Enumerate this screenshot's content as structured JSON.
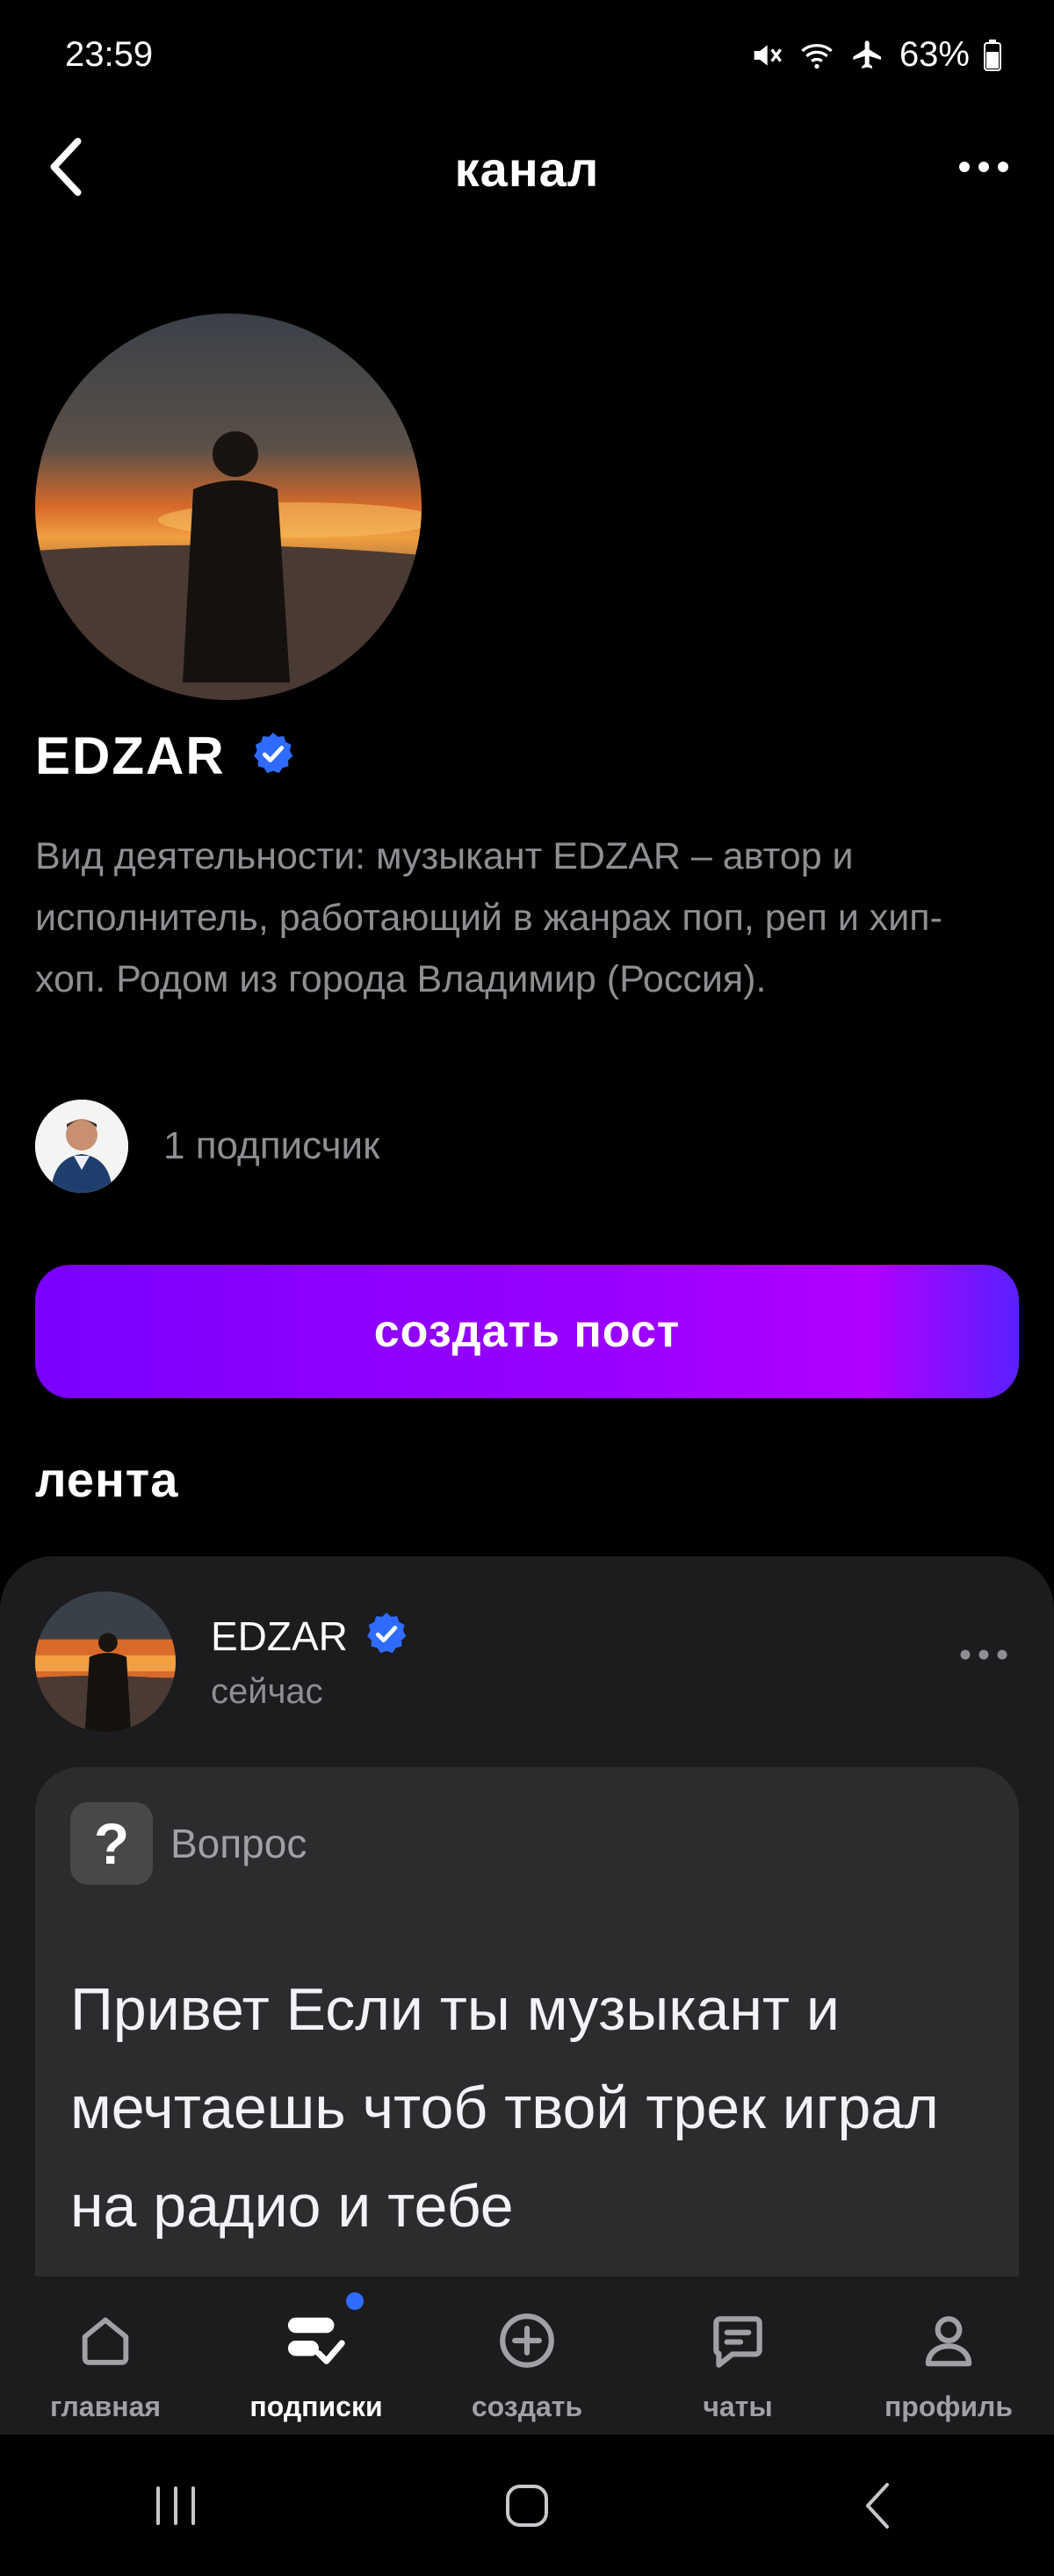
{
  "status_bar": {
    "time": "23:59",
    "battery": "63%"
  },
  "header": {
    "title": "канал"
  },
  "channel": {
    "name": "EDZAR",
    "description": "Вид деятельности: музыкант EDZAR – автор и исполнитель, работающий в жанрах поп, реп и хип-хоп. Родом из города Владимир (Россия).",
    "subscribers": "1 подписчик"
  },
  "create_post_label": "создать пост",
  "feed_title": "лента",
  "post": {
    "author": "EDZAR",
    "time": "сейчас",
    "type_label": "Вопрос",
    "text": "Привет Если ты музыкант и мечтаешь чтоб твой трек играл на радио и тебе"
  },
  "tabs": [
    {
      "label": "главная",
      "icon": "home-icon"
    },
    {
      "label": "подписки",
      "icon": "subscriptions-icon"
    },
    {
      "label": "создать",
      "icon": "plus-icon"
    },
    {
      "label": "чаты",
      "icon": "chat-icon"
    },
    {
      "label": "профиль",
      "icon": "profile-icon"
    }
  ],
  "colors": {
    "accent_start": "#7a00ff",
    "accent_end": "#b000ff",
    "verified": "#2f6bff",
    "background": "#000000",
    "card": "#1c1c1e"
  }
}
